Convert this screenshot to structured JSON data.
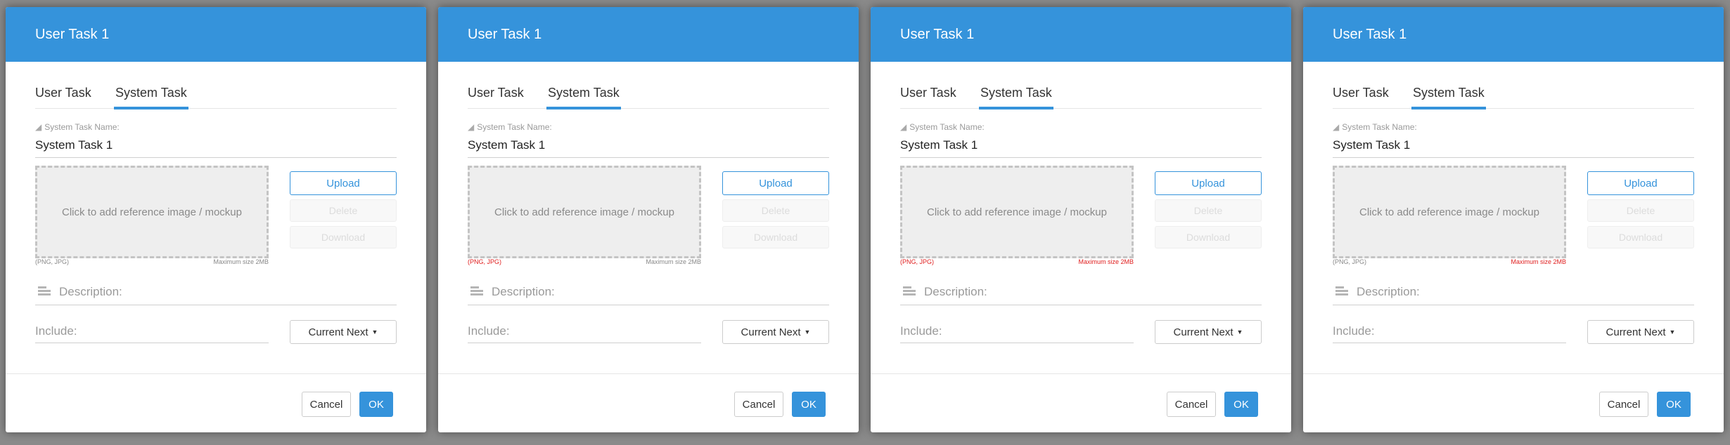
{
  "dialogs": [
    {
      "title": "User Task 1",
      "tabs": [
        "User Task",
        "System Task"
      ],
      "name_label": "System Task Name:",
      "name_value": "System Task 1",
      "dropzone_text": "Click to add reference image / mockup",
      "formats_hint": "(PNG, JPG)",
      "size_hint": "Maximum size 2MB",
      "formats_error": false,
      "size_error": false,
      "upload_label": "Upload",
      "delete_label": "Delete",
      "download_label": "Download",
      "description_placeholder": "Description:",
      "include_placeholder": "Include:",
      "current_next_label": "Current Next",
      "cancel_label": "Cancel",
      "ok_label": "OK"
    },
    {
      "title": "User Task 1",
      "tabs": [
        "User Task",
        "System Task"
      ],
      "name_label": "System Task Name:",
      "name_value": "System Task 1",
      "dropzone_text": "Click to add reference image / mockup",
      "formats_hint": "(PNG, JPG)",
      "size_hint": "Maximum size 2MB",
      "formats_error": true,
      "size_error": false,
      "upload_label": "Upload",
      "delete_label": "Delete",
      "download_label": "Download",
      "description_placeholder": "Description:",
      "include_placeholder": "Include:",
      "current_next_label": "Current Next",
      "cancel_label": "Cancel",
      "ok_label": "OK"
    },
    {
      "title": "User Task 1",
      "tabs": [
        "User Task",
        "System Task"
      ],
      "name_label": "System Task Name:",
      "name_value": "System Task 1",
      "dropzone_text": "Click to add reference image / mockup",
      "formats_hint": "(PNG, JPG)",
      "size_hint": "Maximum size 2MB",
      "formats_error": true,
      "size_error": true,
      "upload_label": "Upload",
      "delete_label": "Delete",
      "download_label": "Download",
      "description_placeholder": "Description:",
      "include_placeholder": "Include:",
      "current_next_label": "Current Next",
      "cancel_label": "Cancel",
      "ok_label": "OK"
    },
    {
      "title": "User Task 1",
      "tabs": [
        "User Task",
        "System Task"
      ],
      "name_label": "System Task Name:",
      "name_value": "System Task 1",
      "dropzone_text": "Click to add reference image / mockup",
      "formats_hint": "(PNG, JPG)",
      "size_hint": "Maximum size 2MB",
      "formats_error": false,
      "size_error": true,
      "upload_label": "Upload",
      "delete_label": "Delete",
      "download_label": "Download",
      "description_placeholder": "Description:",
      "include_placeholder": "Include:",
      "current_next_label": "Current Next",
      "cancel_label": "Cancel",
      "ok_label": "OK"
    }
  ],
  "colors": {
    "header": "#3593db",
    "error": "#e02020",
    "backdrop": "#8a8a8a"
  },
  "icons": {
    "name_label_icon": "tag-icon",
    "description_icon": "text-lines-icon",
    "dropdown_icon": "caret-down-icon"
  }
}
